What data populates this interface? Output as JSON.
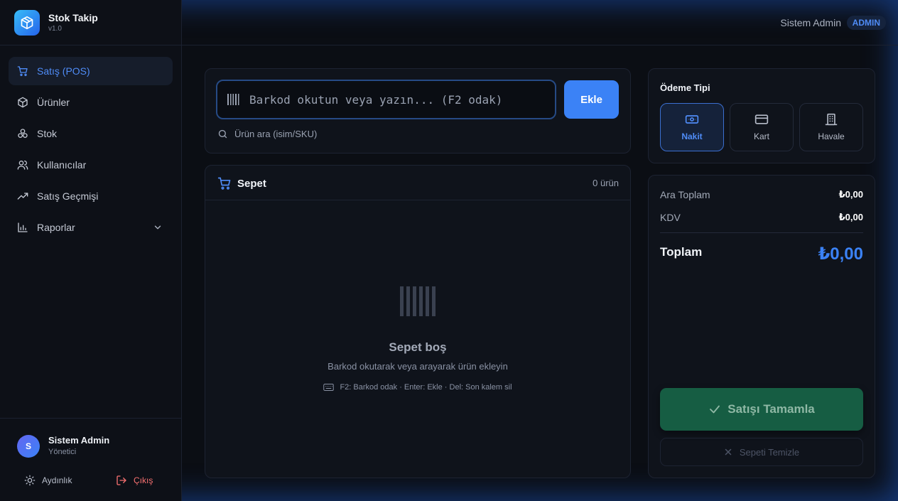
{
  "app": {
    "title": "Stok Takip",
    "version": "v1.0"
  },
  "sidebar": {
    "items": [
      {
        "label": "Satış (POS)",
        "icon": "cart-icon",
        "active": true
      },
      {
        "label": "Ürünler",
        "icon": "box-icon"
      },
      {
        "label": "Stok",
        "icon": "boxes-icon"
      },
      {
        "label": "Kullanıcılar",
        "icon": "users-icon"
      },
      {
        "label": "Satış Geçmişi",
        "icon": "trend-icon"
      },
      {
        "label": "Raporlar",
        "icon": "bar-chart-icon"
      }
    ],
    "user": {
      "initial": "S",
      "name": "Sistem Admin",
      "role": "Yönetici"
    },
    "theme_label": "Aydınlık",
    "logout_label": "Çıkış"
  },
  "topbar": {
    "user_name": "Sistem Admin",
    "role_badge": "ADMIN"
  },
  "scan": {
    "placeholder": "Barkod okutun veya yazın... (F2 odak)",
    "add_label": "Ekle",
    "search_label": "Ürün ara (isim/SKU)"
  },
  "cart": {
    "title": "Sepet",
    "count": "0 ürün",
    "empty_title": "Sepet boş",
    "empty_sub": "Barkod okutarak veya arayarak ürün ekleyin",
    "shortcuts": "F2: Barkod odak · Enter: Ekle · Del: Son kalem sil"
  },
  "payment": {
    "title": "Ödeme Tipi",
    "options": [
      {
        "label": "Nakit",
        "icon": "cash-icon",
        "selected": true
      },
      {
        "label": "Kart",
        "icon": "card-icon"
      },
      {
        "label": "Havale",
        "icon": "bank-icon"
      }
    ]
  },
  "summary": {
    "subtotal_label": "Ara Toplam",
    "subtotal_value": "₺0,00",
    "tax_label": "KDV",
    "tax_value": "₺0,00",
    "total_label": "Toplam",
    "total_value": "₺0,00",
    "complete_label": "Satışı Tamamla",
    "clear_label": "Sepeti Temizle"
  },
  "colors": {
    "accent": "#3b82f6",
    "success": "#165d43",
    "danger": "#f87171"
  }
}
